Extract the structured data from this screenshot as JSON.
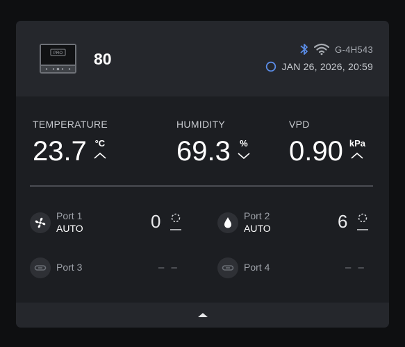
{
  "header": {
    "device_name": "80",
    "device_id": "G-4H543",
    "datetime": "JAN 26, 2026, 20:59",
    "device_screen_text": "PRO"
  },
  "metrics": [
    {
      "label": "TEMPERATURE",
      "value": "23.7",
      "unit": "°C",
      "trend": "up"
    },
    {
      "label": "HUMIDITY",
      "value": "69.3",
      "unit": "%",
      "trend": "down"
    },
    {
      "label": "VPD",
      "value": "0.90",
      "unit": "kPa",
      "trend": "up"
    }
  ],
  "ports": [
    {
      "name": "Port 1",
      "mode": "AUTO",
      "level": "0",
      "icon": "fan-icon"
    },
    {
      "name": "Port 2",
      "mode": "AUTO",
      "level": "6",
      "icon": "drop-icon"
    },
    {
      "name": "Port 3",
      "level": "– –",
      "icon": "plug-icon"
    },
    {
      "name": "Port 4",
      "level": "– –",
      "icon": "plug-icon"
    }
  ],
  "icons": {
    "bluetooth": "bluetooth-icon",
    "wifi": "wifi-icon",
    "clock": "clock-status-icon",
    "expand": "chevron-up-icon"
  },
  "colors": {
    "accent": "#5b8de8",
    "card_bg": "#1c1e22",
    "header_bg": "#25272c",
    "page_bg": "#0e0f11"
  }
}
